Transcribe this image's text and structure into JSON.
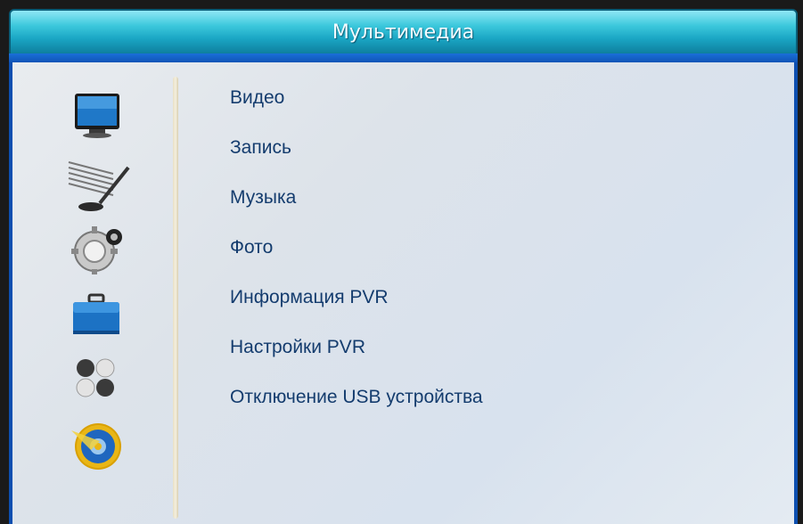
{
  "header": {
    "title": "Мультимедиа"
  },
  "sidebar": {
    "icons": [
      {
        "name": "tv-icon"
      },
      {
        "name": "antenna-icon"
      },
      {
        "name": "gear-icon"
      },
      {
        "name": "toolbox-icon"
      },
      {
        "name": "dots-icon"
      },
      {
        "name": "multimedia-disc-icon",
        "selected": true
      }
    ]
  },
  "menu": {
    "items": [
      {
        "label": "Видео"
      },
      {
        "label": "Запись"
      },
      {
        "label": "Музыка"
      },
      {
        "label": "Фото"
      },
      {
        "label": "Информация PVR"
      },
      {
        "label": "Настройки PVR"
      },
      {
        "label": "Отключение USB устройства"
      }
    ]
  },
  "colors": {
    "title_bar": "#1aa6c4",
    "frame_blue": "#0d4fb0",
    "menu_text": "#143c6e",
    "panel_bg": "#dde3ea"
  }
}
